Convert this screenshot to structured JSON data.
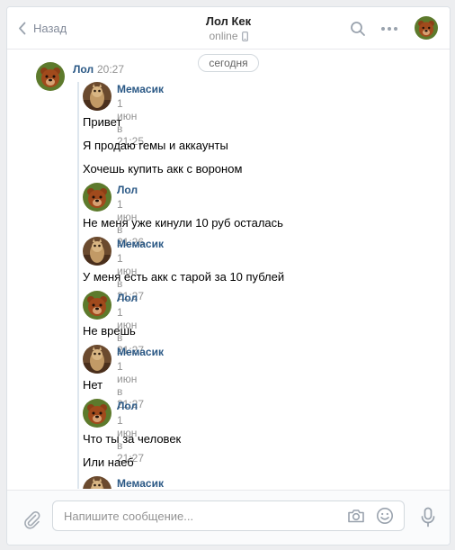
{
  "header": {
    "back_label": "Назад",
    "title": "Лол Кек",
    "status": "online"
  },
  "conversation": {
    "date_divider": "сегодня",
    "main_message": {
      "author": "Лол",
      "time": "20:27"
    },
    "forwarded": [
      {
        "author": "Мемасик",
        "date": "1 июн в 21:25",
        "avatar": "cat",
        "lines": [
          "Привет",
          "Я продаю гемы и аккаунты",
          "Хочешь купить акк с вороном"
        ]
      },
      {
        "author": "Лол",
        "date": "1 июн в 21:26",
        "avatar": "bear",
        "lines": [
          "Не меня уже кинули 10 руб осталась"
        ]
      },
      {
        "author": "Мемасик",
        "date": "1 июн в 21:27",
        "avatar": "cat",
        "lines": [
          "У меня есть акк с тарой за 10 публей"
        ]
      },
      {
        "author": "Лол",
        "date": "1 июн в 21:27",
        "avatar": "bear",
        "lines": [
          "Не врешь"
        ]
      },
      {
        "author": "Мемасик",
        "date": "1 июн в 21:27",
        "avatar": "cat",
        "lines": [
          "Нет"
        ]
      },
      {
        "author": "Лол",
        "date": "1 июн в 21:27",
        "avatar": "bear",
        "lines": [
          "Что ты за человек",
          "Или наеб"
        ]
      },
      {
        "author": "Мемасик",
        "date": "",
        "avatar": "cat",
        "lines": []
      }
    ]
  },
  "composer": {
    "placeholder": "Напишите сообщение..."
  },
  "colors": {
    "link": "#2a5885",
    "muted": "#939393",
    "background": "#edeef0",
    "border": "#dce1e6"
  },
  "icons": [
    "chevron-left-icon",
    "mobile-icon",
    "search-icon",
    "more-icon",
    "paperclip-icon",
    "camera-icon",
    "smile-icon",
    "microphone-icon"
  ]
}
